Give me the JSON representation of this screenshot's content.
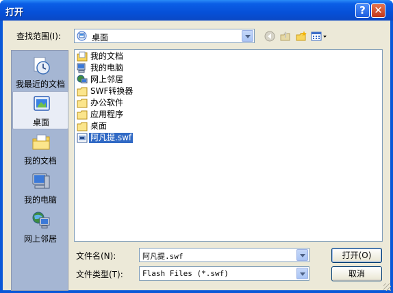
{
  "window": {
    "title": "打开",
    "help_glyph": "?",
    "close_glyph": "✕"
  },
  "lookin": {
    "label": "查找范围(I):",
    "value": "桌面",
    "icon": "desktop-icon"
  },
  "toolbar": {
    "icons": [
      "back-icon",
      "up-folder-icon",
      "new-folder-icon",
      "views-menu-icon"
    ]
  },
  "places": [
    {
      "label": "我最近的文档",
      "icon": "recent-documents-icon",
      "selected": false
    },
    {
      "label": "桌面",
      "icon": "desktop-icon",
      "selected": true
    },
    {
      "label": "我的文档",
      "icon": "my-documents-icon",
      "selected": false
    },
    {
      "label": "我的电脑",
      "icon": "my-computer-icon",
      "selected": false
    },
    {
      "label": "网上邻居",
      "icon": "network-icon",
      "selected": false
    }
  ],
  "files": [
    {
      "name": "我的文档",
      "icon": "my-documents-icon",
      "selected": false
    },
    {
      "name": "我的电脑",
      "icon": "my-computer-icon",
      "selected": false
    },
    {
      "name": "网上邻居",
      "icon": "network-icon",
      "selected": false
    },
    {
      "name": "SWF转换器",
      "icon": "folder-icon",
      "selected": false
    },
    {
      "name": "办公软件",
      "icon": "folder-icon",
      "selected": false
    },
    {
      "name": "应用程序",
      "icon": "folder-icon",
      "selected": false
    },
    {
      "name": "桌面",
      "icon": "folder-icon",
      "selected": false
    },
    {
      "name": "阿凡提.swf",
      "icon": "swf-file-icon",
      "selected": true
    }
  ],
  "filename": {
    "label": "文件名(N):",
    "value": "阿凡提.swf"
  },
  "filetype": {
    "label": "文件类型(T):",
    "value": "Flash Files (*.swf)"
  },
  "buttons": {
    "open": "打开(O)",
    "cancel": "取消"
  },
  "colors": {
    "titlebar": "#0a58d8",
    "selection": "#316ac5",
    "dialog_bg": "#ece9d8"
  }
}
